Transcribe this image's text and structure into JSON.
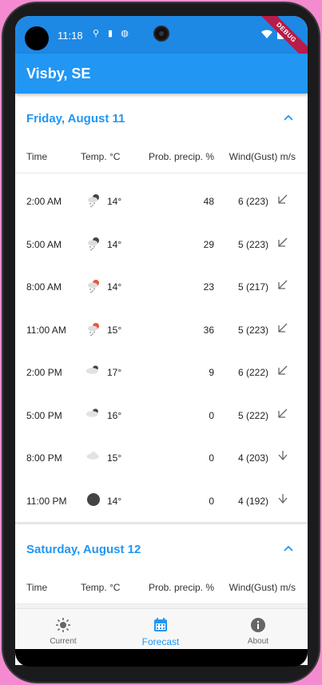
{
  "status_bar": {
    "time": "11:18",
    "debug_label": "DEBUG"
  },
  "app_bar": {
    "title": "Visby, SE"
  },
  "columns": {
    "time": "Time",
    "temp": "Temp. °C",
    "prob": "Prob. precip. %",
    "wind": "Wind(Gust) m/s"
  },
  "sections": [
    {
      "title": "Friday, August 11",
      "rows": [
        {
          "time": "2:00 AM",
          "icon": "snow-cloud-icon",
          "temp": "14°",
          "prob": "48",
          "wind": "6 (223)"
        },
        {
          "time": "5:00 AM",
          "icon": "snow-cloud-icon",
          "temp": "14°",
          "prob": "29",
          "wind": "5 (223)"
        },
        {
          "time": "8:00 AM",
          "icon": "sleet-sun-icon",
          "temp": "14°",
          "prob": "23",
          "wind": "5 (217)"
        },
        {
          "time": "11:00 AM",
          "icon": "sleet-sun-icon",
          "temp": "15°",
          "prob": "36",
          "wind": "5 (223)"
        },
        {
          "time": "2:00 PM",
          "icon": "partly-cloudy-night-icon",
          "temp": "17°",
          "prob": "9",
          "wind": "6 (222)"
        },
        {
          "time": "5:00 PM",
          "icon": "partly-cloudy-night-icon",
          "temp": "16°",
          "prob": "0",
          "wind": "5 (222)"
        },
        {
          "time": "8:00 PM",
          "icon": "cloud-icon",
          "temp": "15°",
          "prob": "0",
          "wind": "4 (203)"
        },
        {
          "time": "11:00 PM",
          "icon": "clear-night-icon",
          "temp": "14°",
          "prob": "0",
          "wind": "4 (192)"
        }
      ]
    },
    {
      "title": "Saturday, August 12",
      "rows": []
    }
  ],
  "bottom_nav": {
    "current": "Current",
    "forecast": "Forecast",
    "about": "About"
  },
  "colors": {
    "primary": "#2196f3",
    "status_bar": "#1e88e5",
    "debug_ribbon": "#b71c4a"
  }
}
